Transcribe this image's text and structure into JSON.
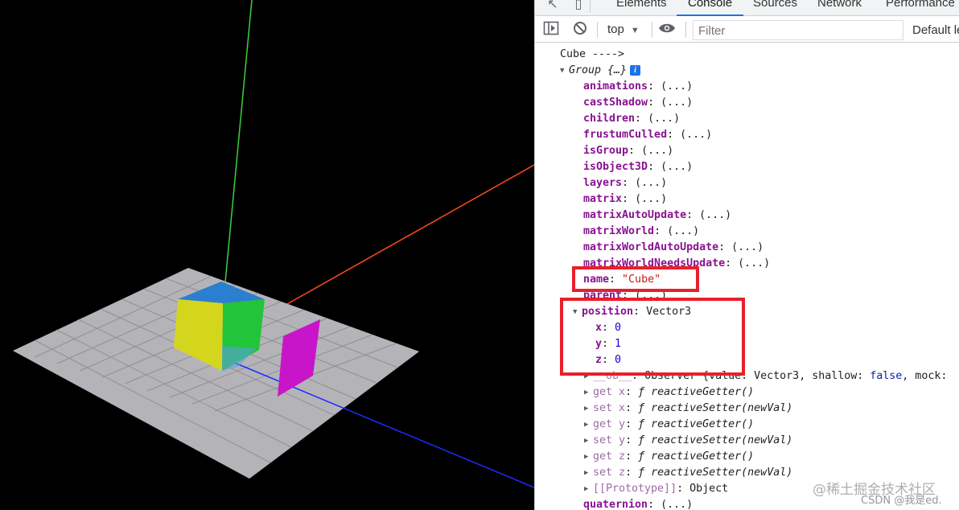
{
  "devtools": {
    "tabs": [
      "Elements",
      "Console",
      "Sources",
      "Network",
      "Performance"
    ],
    "active_tab": "Console",
    "toolbar": {
      "context": "top",
      "filter_placeholder": "Filter",
      "levels": "Default le"
    }
  },
  "console": {
    "log_label": "Cube ---->",
    "group_label": "Group {…}",
    "info_badge": "i",
    "props": [
      {
        "key": "animations",
        "value": "(...)"
      },
      {
        "key": "castShadow",
        "value": "(...)"
      },
      {
        "key": "children",
        "value": "(...)"
      },
      {
        "key": "frustumCulled",
        "value": "(...)"
      },
      {
        "key": "isGroup",
        "value": "(...)"
      },
      {
        "key": "isObject3D",
        "value": "(...)"
      },
      {
        "key": "layers",
        "value": "(...)"
      },
      {
        "key": "matrix",
        "value": "(...)"
      },
      {
        "key": "matrixAutoUpdate",
        "value": "(...)"
      },
      {
        "key": "matrixWorld",
        "value": "(...)"
      },
      {
        "key": "matrixWorldAutoUpdate",
        "value": "(...)"
      },
      {
        "key": "matrixWorldNeedsUpdate",
        "value": "(...)"
      }
    ],
    "name_key": "name",
    "name_value": "\"Cube\"",
    "parent_key": "parent",
    "parent_value": "(...)",
    "position_key": "position",
    "position_value": "Vector3",
    "coords": [
      {
        "key": "x",
        "value": "0"
      },
      {
        "key": "y",
        "value": "1"
      },
      {
        "key": "z",
        "value": "0"
      }
    ],
    "ob_key": "__ob__",
    "ob_value_prefix": "Observer {value: Vector3, shallow: ",
    "ob_value_false": "false",
    "ob_value_suffix": ", mock:",
    "accessors": [
      {
        "kind": "get",
        "axis": "x",
        "fn": "reactiveGetter()"
      },
      {
        "kind": "set",
        "axis": "x",
        "fn": "reactiveSetter(newVal)"
      },
      {
        "kind": "get",
        "axis": "y",
        "fn": "reactiveGetter()"
      },
      {
        "kind": "set",
        "axis": "y",
        "fn": "reactiveSetter(newVal)"
      },
      {
        "kind": "get",
        "axis": "z",
        "fn": "reactiveGetter()"
      },
      {
        "kind": "set",
        "axis": "z",
        "fn": "reactiveSetter(newVal)"
      }
    ],
    "prototype_key": "[[Prototype]]",
    "prototype_value": "Object",
    "quaternion_key": "quaternion",
    "quaternion_value": "(...)"
  },
  "watermark": {
    "main": "@稀土掘金技术社区",
    "sub": "CSDN @我是ed."
  },
  "colors": {
    "highlight": "#e8202a",
    "active_tab_underline": "#1a73e8",
    "axis_x": "#ff4a1a",
    "axis_y": "#3cd23c",
    "axis_z": "#1a2cff",
    "cube_top": "#2b7fcf",
    "cube_front": "#d4d61e",
    "cube_side": "#22c43a",
    "plane": "#c915c9",
    "floor": "#b4b4b8"
  },
  "icons": [
    "inspect-icon",
    "device-toggle-icon",
    "sidebar-toggle-icon",
    "clear-console-icon",
    "eye-icon",
    "dropdown-caret-icon",
    "expand-arrow-icon",
    "collapse-arrow-icon",
    "info-icon"
  ]
}
